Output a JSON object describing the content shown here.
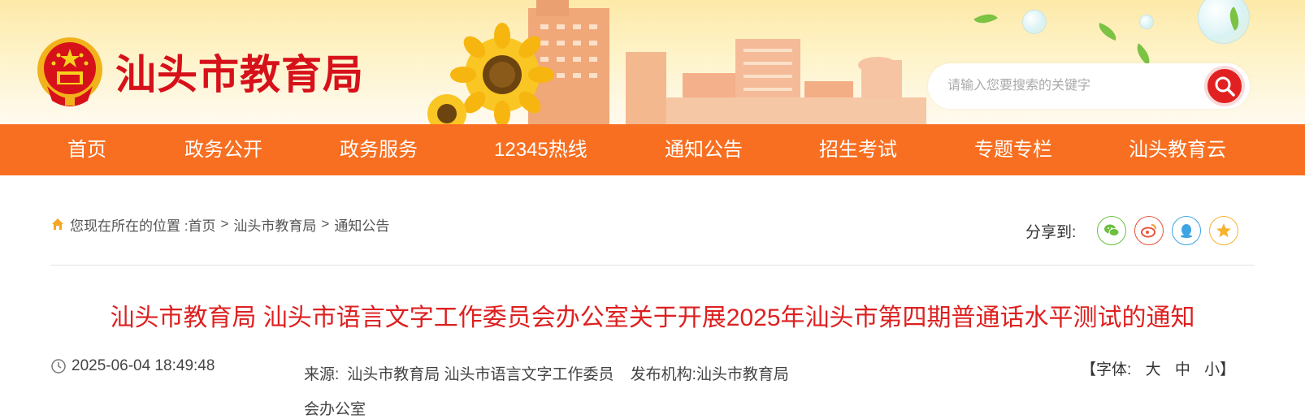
{
  "header": {
    "site_title": "汕头市教育局",
    "search_placeholder": "请输入您要搜索的关键字"
  },
  "nav": {
    "items": [
      {
        "label": "首页"
      },
      {
        "label": "政务公开"
      },
      {
        "label": "政务服务"
      },
      {
        "label": "12345热线"
      },
      {
        "label": "通知公告"
      },
      {
        "label": "招生考试"
      },
      {
        "label": "专题专栏"
      },
      {
        "label": "汕头教育云"
      }
    ]
  },
  "breadcrumb": {
    "prefix": "您现在所在的位置 : ",
    "items": [
      "首页",
      "汕头市教育局",
      "通知公告"
    ],
    "separator": ">"
  },
  "share": {
    "label": "分享到:",
    "targets": [
      "wechat-icon",
      "weibo-icon",
      "qq-icon",
      "qzone-icon"
    ]
  },
  "article": {
    "title": "汕头市教育局 汕头市语言文字工作委员会办公室关于开展2025年汕头市第四期普通话水平测试的通知",
    "date": "2025-06-04 18:49:48",
    "source_label": "来源:",
    "source": "汕头市教育局 汕头市语言文字工作委员",
    "source_cont": "会办公室",
    "publisher_label": "发布机构:",
    "publisher": "汕头市教育局",
    "font_size_label": "【字体:",
    "font_size_options": [
      "大",
      "中",
      "小"
    ],
    "font_size_close": "】"
  },
  "colors": {
    "nav_bg": "#f86f21",
    "title_red": "#dd2020",
    "brand_red": "#d7111a"
  }
}
